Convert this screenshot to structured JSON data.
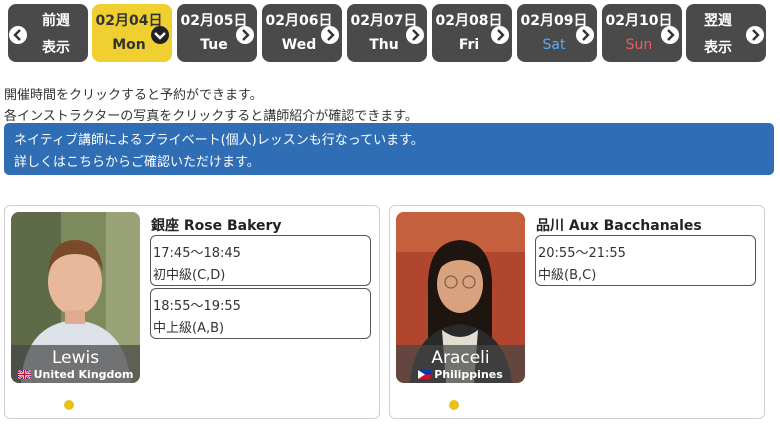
{
  "nav": {
    "prev": {
      "line1": "前週",
      "line2": "表示"
    },
    "next": {
      "line1": "翌週",
      "line2": "表示"
    },
    "days": [
      {
        "date": "02月04日",
        "dow": "Mon",
        "selected": true
      },
      {
        "date": "02月05日",
        "dow": "Tue"
      },
      {
        "date": "02月06日",
        "dow": "Wed"
      },
      {
        "date": "02月07日",
        "dow": "Thu"
      },
      {
        "date": "02月08日",
        "dow": "Fri"
      },
      {
        "date": "02月09日",
        "dow": "Sat"
      },
      {
        "date": "02月10日",
        "dow": "Sun"
      }
    ]
  },
  "info": {
    "line1": "開催時間をクリックすると予約ができます。",
    "line2": "各インストラクターの写真をクリックすると講師紹介が確認できます。"
  },
  "banner": {
    "line1": "ネイティブ講師によるプライベート(個人)レッスンも行なっています。",
    "line2": "詳しくはこちらからご確認いただけます。"
  },
  "cards": [
    {
      "instructor": "Lewis",
      "country": "United Kingdom",
      "studio": "銀座 Rose Bakery",
      "slots": [
        {
          "time": "17:45～18:45",
          "level": "初中級(C,D)"
        },
        {
          "time": "18:55～19:55",
          "level": "中上級(A,B)"
        }
      ]
    },
    {
      "instructor": "Araceli",
      "country": "Philippines",
      "studio": "品川 Aux Bacchanales",
      "slots": [
        {
          "time": "20:55～21:55",
          "level": "中級(B,C)"
        }
      ]
    }
  ],
  "colors": {
    "tab_bg": "#4a4a4a",
    "tab_selected": "#f0d030",
    "banner_bg": "#2f6db5",
    "saturday": "#5aaaf0",
    "sunday": "#f05a5a",
    "dot": "#e8c21a"
  }
}
